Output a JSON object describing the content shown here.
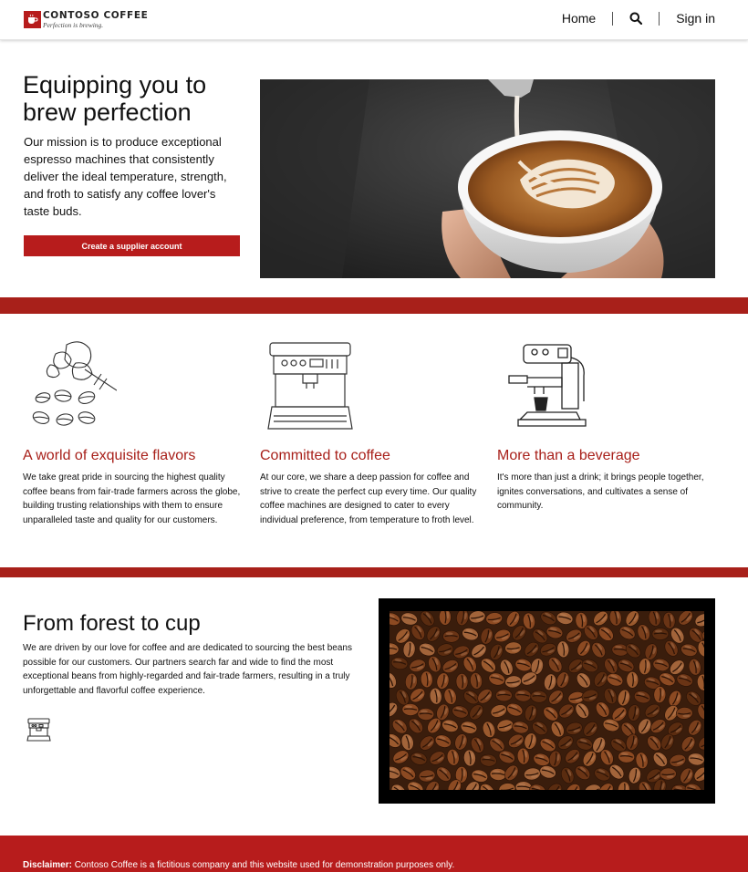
{
  "header": {
    "brand_name": "CONTOSO COFFEE",
    "brand_tagline": "Perfection is brewing.",
    "nav": {
      "home": "Home",
      "sign_in": "Sign in"
    }
  },
  "hero": {
    "title": "Equipping you to brew perfection",
    "text": "Our mission is to produce exceptional espresso machines that consistently deliver the ideal temperature, strength, and froth to satisfy any coffee lover's taste buds.",
    "button_label": "Create a supplier account"
  },
  "features": [
    {
      "title": "A world of exquisite flavors",
      "text": "We take great pride in sourcing the highest quality coffee beans from fair-trade farmers across the globe, building trusting relationships with them to ensure unparalleled taste and quality for our customers."
    },
    {
      "title": "Committed to coffee",
      "text": "At our core, we share a deep passion for coffee and strive to create the perfect cup every time. Our quality coffee machines are designed to cater to every individual preference, from temperature to froth level."
    },
    {
      "title": "More than a beverage",
      "text": "It's more than just a drink; it brings people together, ignites conversations, and cultivates a sense of community."
    }
  ],
  "forest": {
    "title": "From forest to cup",
    "text": "We are driven by our love for coffee and are dedicated to sourcing the best beans possible for our customers. Our partners search far and wide to find the most exceptional beans from highly-regarded and fair-trade farmers, resulting in a truly unforgettable and flavorful coffee experience."
  },
  "footer": {
    "label": "Disclaimer:",
    "text": " Contoso Coffee is a fictitious company and this website used for demonstration purposes only."
  },
  "icons": {
    "logo": "coffee-cup-logo-icon",
    "search": "search-icon",
    "feature_1": "coffee-beans-icon",
    "feature_2": "espresso-machine-icon",
    "feature_3": "coffee-maker-icon",
    "forest": "espresso-machine-small-icon"
  },
  "colors": {
    "brand_red": "#b71c1c",
    "band_red": "#a8201a",
    "heading_red": "#a8201a"
  }
}
